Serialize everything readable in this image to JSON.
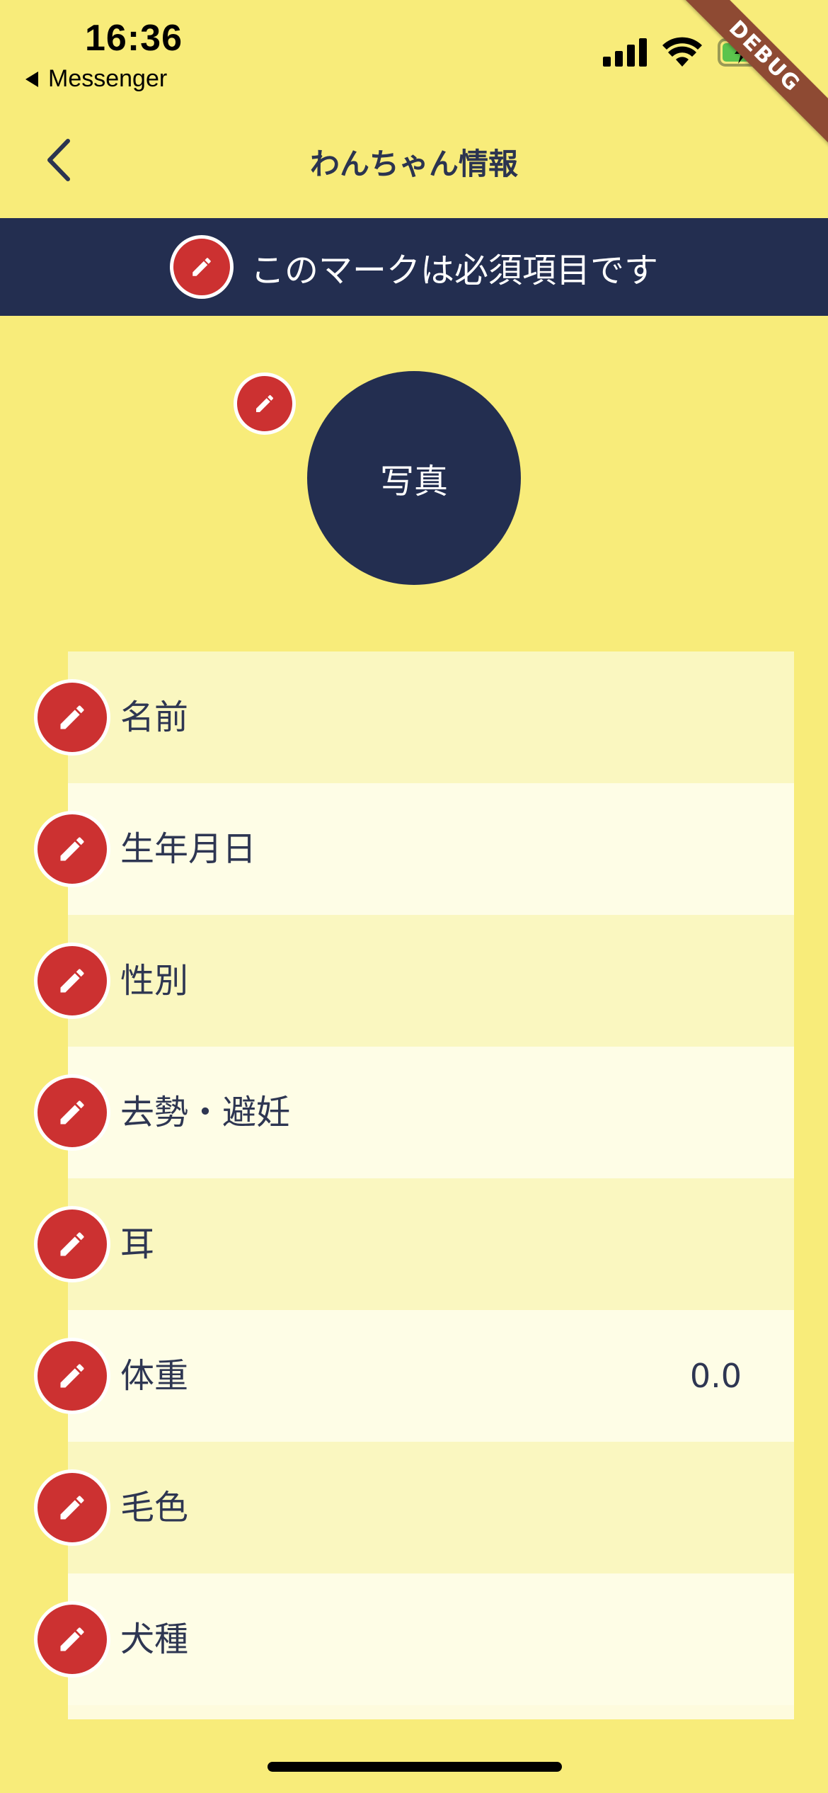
{
  "status_bar": {
    "time": "16:36",
    "back_app": "Messenger",
    "debug_label": "DEBUG"
  },
  "nav": {
    "title": "わんちゃん情報"
  },
  "banner": {
    "text": "このマークは必須項目です"
  },
  "photo": {
    "label": "写真"
  },
  "fields": [
    {
      "label": "名前",
      "value": ""
    },
    {
      "label": "生年月日",
      "value": ""
    },
    {
      "label": "性別",
      "value": ""
    },
    {
      "label": "去勢・避妊",
      "value": ""
    },
    {
      "label": "耳",
      "value": ""
    },
    {
      "label": "体重",
      "value": "0.0"
    },
    {
      "label": "毛色",
      "value": ""
    },
    {
      "label": "犬種",
      "value": ""
    }
  ],
  "colors": {
    "background": "#F8EC7A",
    "navy": "#232E50",
    "required_red": "#CC3131"
  },
  "icons": {
    "required": "pencil-icon",
    "back": "chevron-left-icon"
  }
}
